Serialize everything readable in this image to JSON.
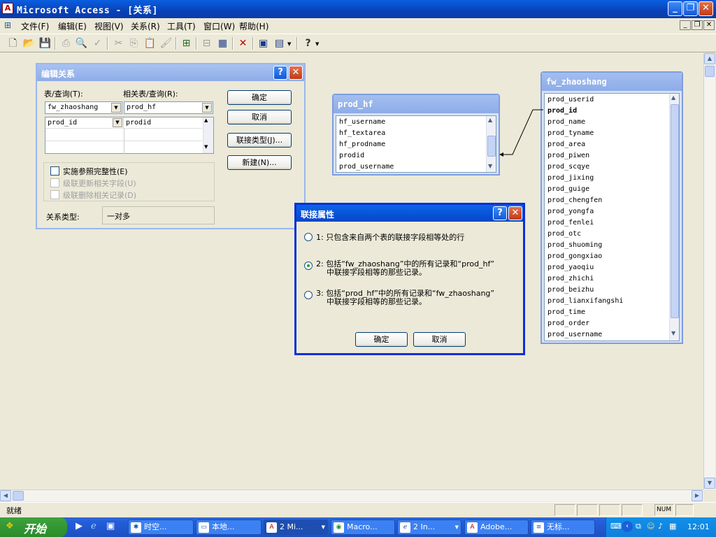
{
  "window": {
    "title": "Microsoft Access - [关系]",
    "app_icon": "A"
  },
  "menu": [
    "文件(F)",
    "编辑(E)",
    "视图(V)",
    "关系(R)",
    "工具(T)",
    "窗口(W)",
    "帮助(H)"
  ],
  "status": {
    "text": "就绪",
    "num": "NUM"
  },
  "edit_rel": {
    "title": "编辑关系",
    "table_label": "表/查询(T):",
    "related_label": "相关表/查询(R):",
    "table_value": "fw_zhaoshang",
    "related_value": "prod_hf",
    "field_left": "prod_id",
    "field_right": "prodid",
    "ok": "确定",
    "cancel": "取消",
    "join_type": "联接类型(J)...",
    "new": "新建(N)...",
    "enforce": "实施参照完整性(E)",
    "cascade_update": "级联更新相关字段(U)",
    "cascade_delete": "级联删除相关记录(D)",
    "rel_type_label": "关系类型:",
    "rel_type_value": "一对多"
  },
  "prod_hf": {
    "title": "prod_hf",
    "fields": [
      "hf_username",
      "hf_textarea",
      "hf_prodname",
      "prodid",
      "prod_username"
    ]
  },
  "fw_zhaoshang": {
    "title": "fw_zhaoshang",
    "fields": [
      "prod_userid",
      "prod_id",
      "prod_name",
      "prod_tyname",
      "prod_area",
      "prod_piwen",
      "prod_scqye",
      "prod_jixing",
      "prod_guige",
      "prod_chengfen",
      "prod_yongfa",
      "prod_fenlei",
      "prod_otc",
      "prod_shuoming",
      "prod_gongxiao",
      "prod_yaoqiu",
      "prod_zhichi",
      "prod_beizhu",
      "prod_lianxifangshi",
      "prod_time",
      "prod_order",
      "prod_username"
    ],
    "bold_field": "prod_id"
  },
  "join": {
    "title": "联接属性",
    "opt1": "1: 只包含来自两个表的联接字段相等处的行",
    "opt2_line1": "2: 包括“fw_zhaoshang”中的所有记录和“prod_hf”",
    "opt2_line2": "中联接字段相等的那些记录。",
    "opt3_line1": "3: 包括“prod_hf”中的所有记录和“fw_zhaoshang”",
    "opt3_line2": "中联接字段相等的那些记录。",
    "selected": 2,
    "ok": "确定",
    "cancel": "取消"
  },
  "taskbar": {
    "start": "开始",
    "tasks": [
      "时空...",
      "本地...",
      "2 Mi...",
      "Macro...",
      "2 In...",
      "Adobe...",
      "无标..."
    ],
    "clock": "12:01"
  }
}
